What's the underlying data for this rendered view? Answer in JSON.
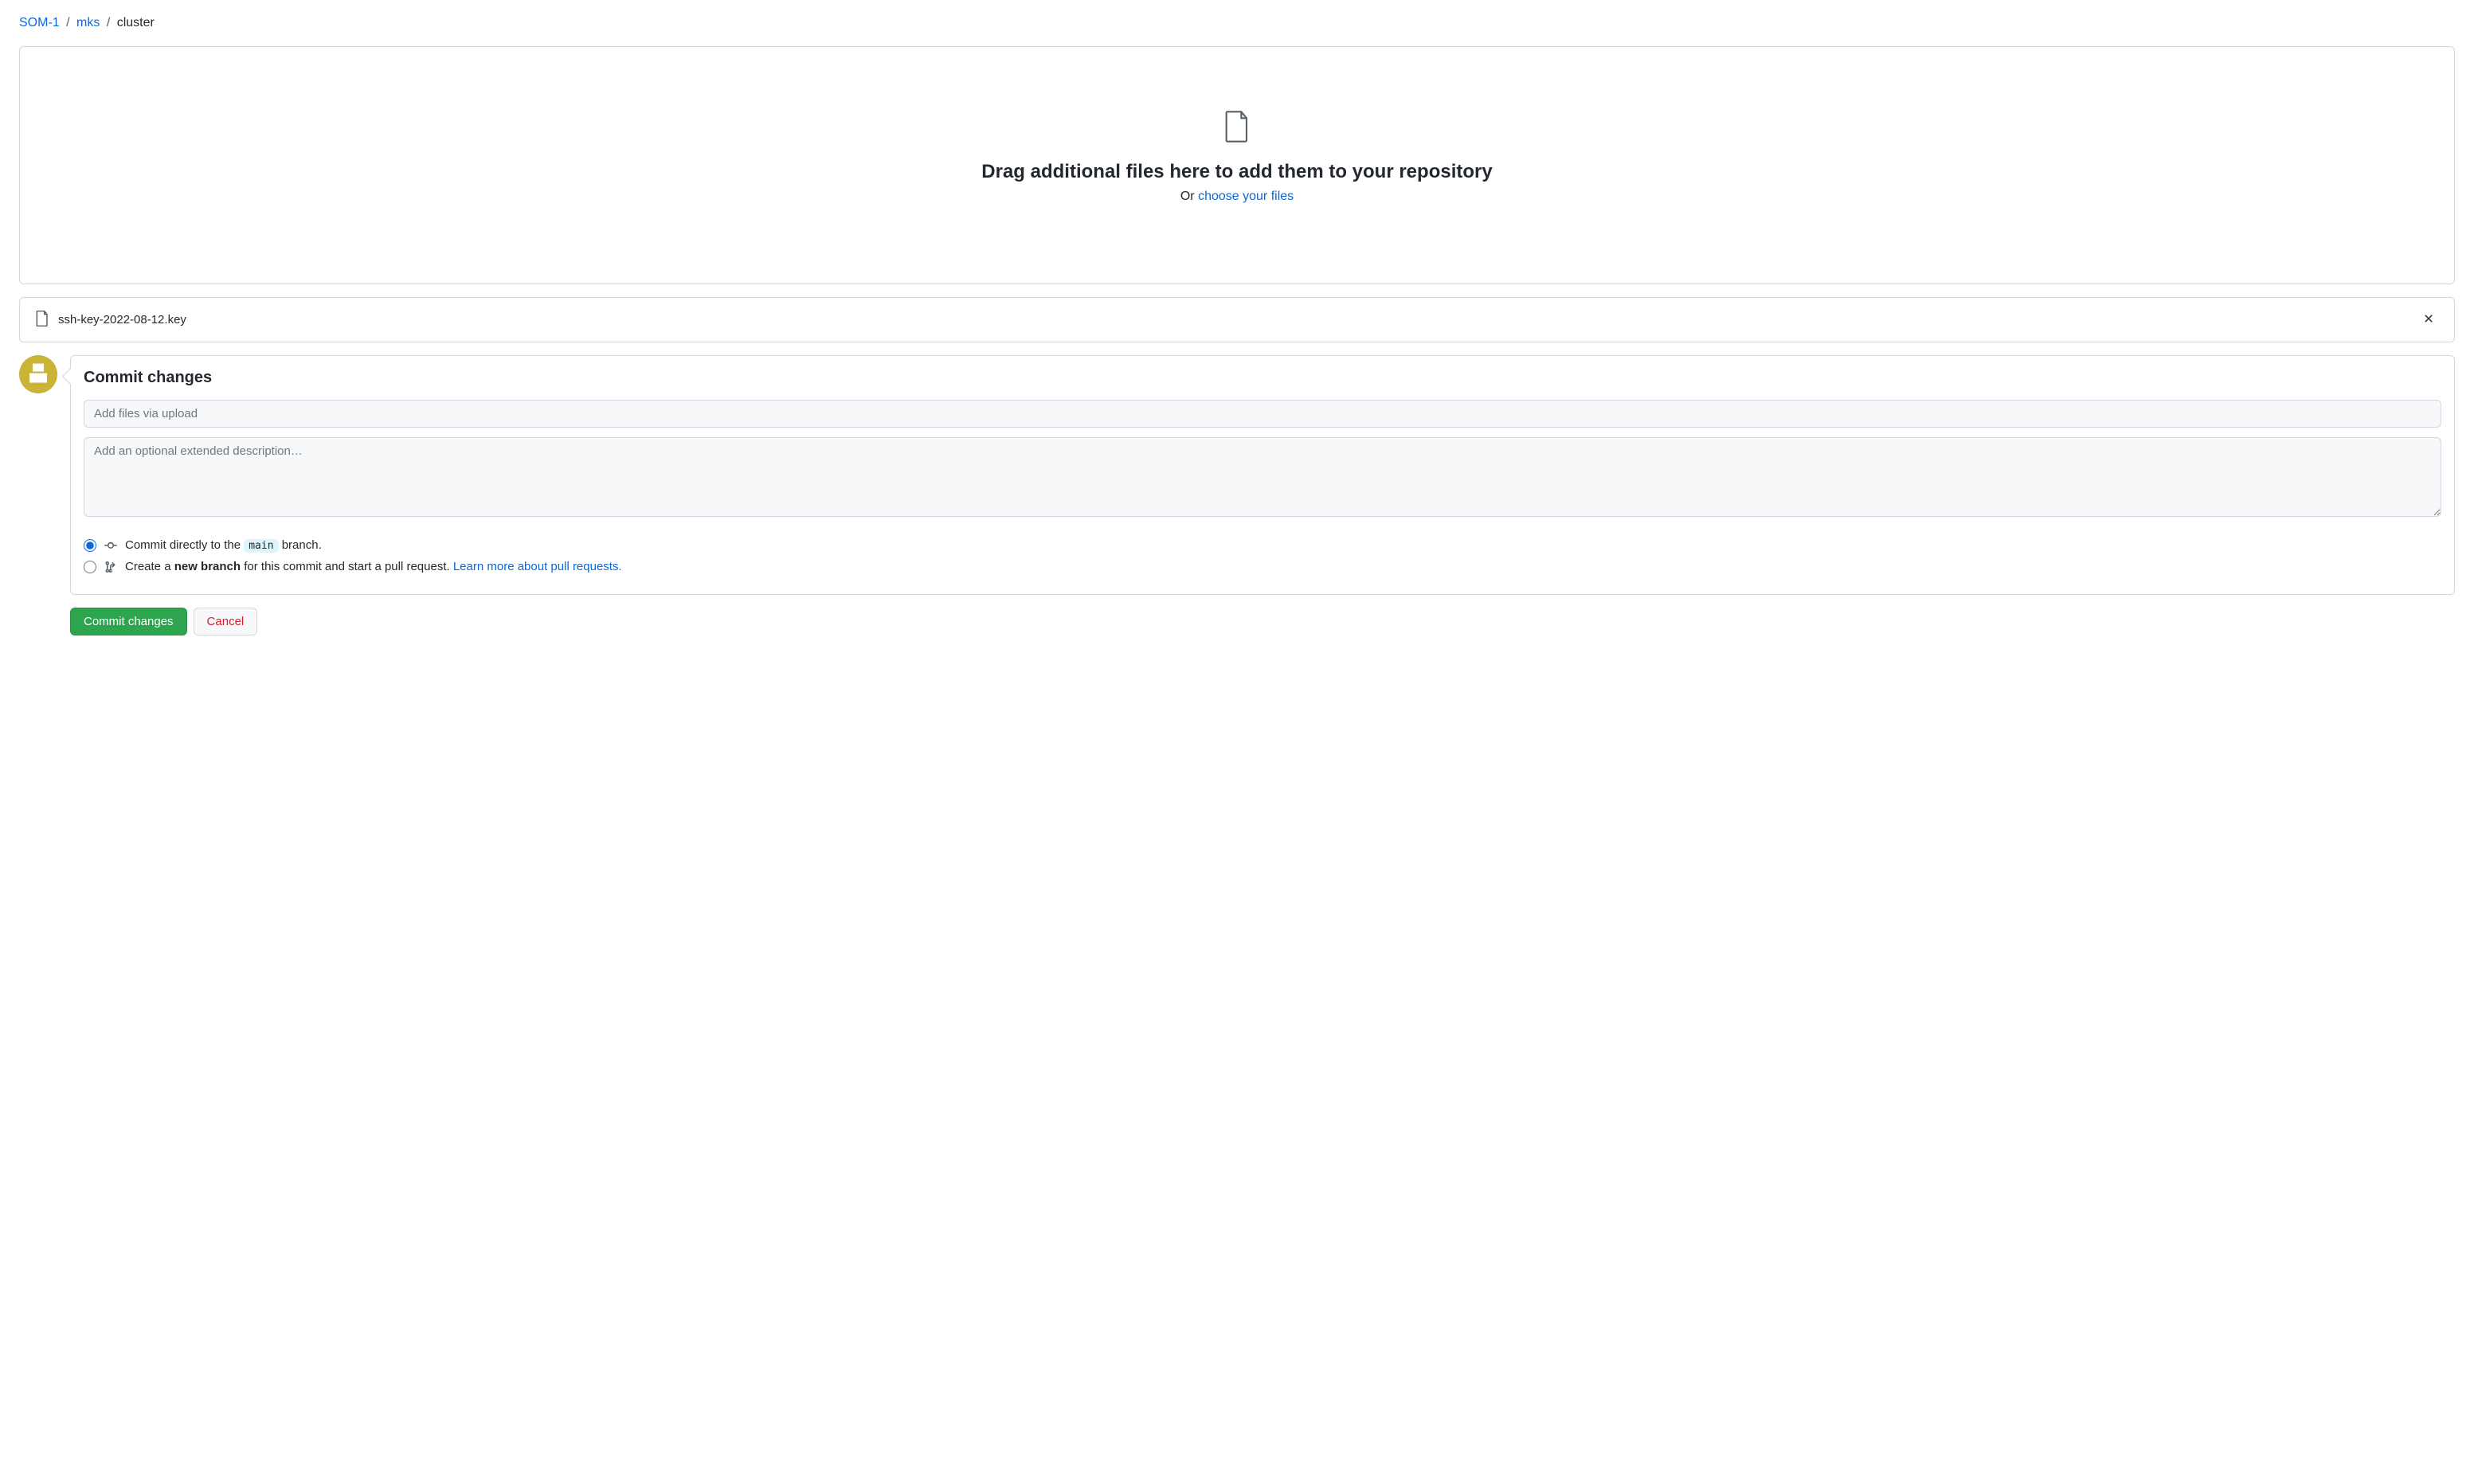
{
  "breadcrumb": {
    "parts": [
      "SOM-1",
      "mks"
    ],
    "current": "cluster",
    "sep": "/"
  },
  "dropzone": {
    "heading": "Drag additional files here to add them to your repository",
    "subtext_prefix": "Or ",
    "choose_link": "choose your files"
  },
  "file_list": [
    {
      "name": "ssh-key-2022-08-12.key"
    }
  ],
  "commit": {
    "heading": "Commit changes",
    "summary_placeholder": "Add files via upload",
    "description_placeholder": "Add an optional extended description…",
    "radio_direct_prefix": "Commit directly to the ",
    "radio_direct_branch": "main",
    "radio_direct_suffix": " branch.",
    "radio_newbranch_prefix": "Create a ",
    "radio_newbranch_bold": "new branch",
    "radio_newbranch_suffix": " for this commit and start a pull request. ",
    "radio_newbranch_link": "Learn more about pull requests."
  },
  "actions": {
    "commit_button": "Commit changes",
    "cancel_button": "Cancel"
  }
}
